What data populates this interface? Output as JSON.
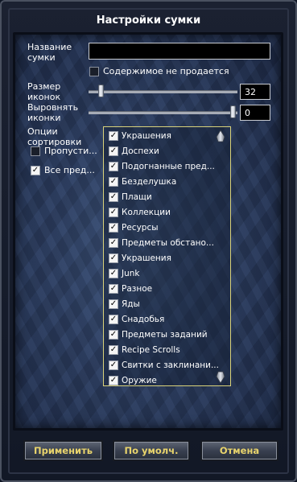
{
  "window": {
    "title": "Настройки сумки"
  },
  "bag_name": {
    "label": "Название сумки",
    "value": ""
  },
  "not_for_sale": {
    "label": "Содержимое не продается",
    "checked": false
  },
  "icon_size": {
    "label": "Размер иконок",
    "value": "32"
  },
  "align_icons": {
    "label": "Выровнять иконки",
    "value": "0"
  },
  "sort_options": {
    "label": "Опции сортировки",
    "skip": {
      "label": "Пропусти...",
      "checked": false
    },
    "all": {
      "label": "Все пред...",
      "checked": true
    }
  },
  "categories": [
    {
      "label": "Украшения",
      "checked": true
    },
    {
      "label": "Доспехи",
      "checked": true
    },
    {
      "label": "Подогнанные пред...",
      "checked": true
    },
    {
      "label": "Безделушка",
      "checked": true
    },
    {
      "label": "Плащи",
      "checked": true
    },
    {
      "label": "Коллекции",
      "checked": true
    },
    {
      "label": "Ресурсы",
      "checked": true
    },
    {
      "label": "Предметы обстано...",
      "checked": true
    },
    {
      "label": "Украшения",
      "checked": true
    },
    {
      "label": "Junk",
      "checked": true
    },
    {
      "label": "Разное",
      "checked": true
    },
    {
      "label": "Яды",
      "checked": true
    },
    {
      "label": "Снадобья",
      "checked": true
    },
    {
      "label": "Предметы заданий",
      "checked": true
    },
    {
      "label": "Recipe Scrolls",
      "checked": true
    },
    {
      "label": "Свитки с заклинани...",
      "checked": true
    },
    {
      "label": "Оружие",
      "checked": true
    }
  ],
  "buttons": {
    "apply": "Применить",
    "defaults": "По умолч.",
    "cancel": "Отмена"
  },
  "colors": {
    "button_text": "#e9d46c",
    "list_border": "#d9d27a"
  }
}
